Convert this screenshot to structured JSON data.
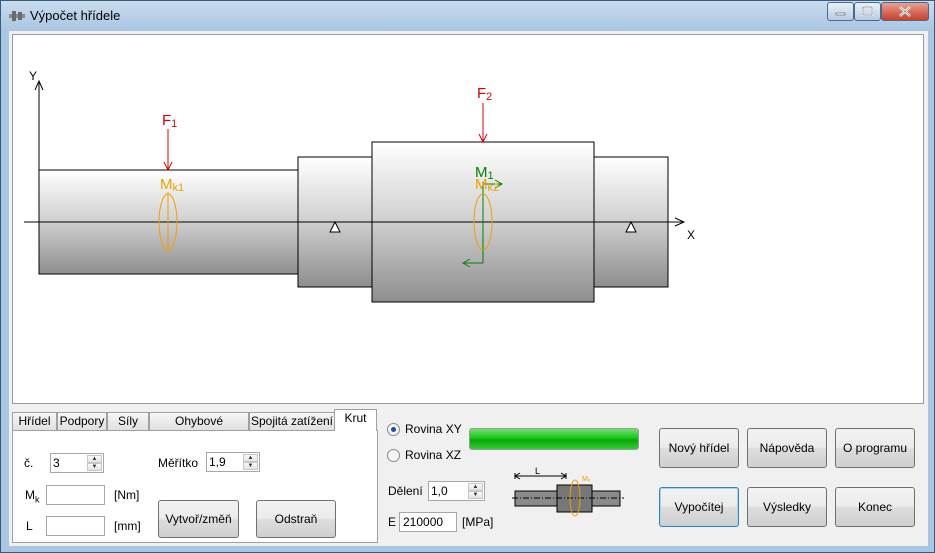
{
  "window": {
    "title": "Výpočet hřídele",
    "controls": [
      "minimize",
      "maximize",
      "close"
    ]
  },
  "canvas": {
    "axis_y": "Y",
    "axis_x": "X",
    "force1": {
      "letter": "F",
      "sub": "1"
    },
    "force2": {
      "letter": "F",
      "sub": "2"
    },
    "torque1": {
      "letter": "M",
      "sub": "k1"
    },
    "torque2": {
      "letter": "M",
      "sub": "k2"
    },
    "moment1": {
      "letter": "M",
      "sub": "1"
    },
    "colors": {
      "force": "#e00000",
      "torque": "#f0a000",
      "moment": "#008000"
    }
  },
  "tabs": [
    {
      "label": "Hřídel",
      "active": false
    },
    {
      "label": "Podpory",
      "active": false
    },
    {
      "label": "Síly",
      "active": false
    },
    {
      "label": "Ohybové momenty",
      "active": false
    },
    {
      "label": "Spojitá zatížení",
      "active": false
    },
    {
      "label": "Krut",
      "active": true
    }
  ],
  "krut": {
    "number_label": "č.",
    "number_value": "3",
    "scale_label": "Měřítko",
    "scale_value": "1,9",
    "mk_label": "M",
    "mk_sub": "k",
    "mk_value": "",
    "mk_unit": "[Nm]",
    "l_label": "L",
    "l_value": "",
    "l_unit": "[mm]",
    "create_button": "Vytvoř/změň",
    "delete_button": "Odstraň"
  },
  "plane": {
    "options": [
      {
        "label": "Rovina XY",
        "selected": true
      },
      {
        "label": "Rovina XZ",
        "selected": false
      }
    ],
    "progress": 1.0
  },
  "division": {
    "label": "Dělení",
    "value": "1,0"
  },
  "modulus": {
    "label": "E",
    "value": "210000",
    "unit": "[MPa]"
  },
  "preview": {
    "length_label": "L",
    "torque_label": "Mₖ"
  },
  "buttons": {
    "new_shaft": "Nový hřídel",
    "help": "Nápověda",
    "about": "O programu",
    "calculate": "Vypočítej",
    "results": "Výsledky",
    "exit": "Konec"
  }
}
